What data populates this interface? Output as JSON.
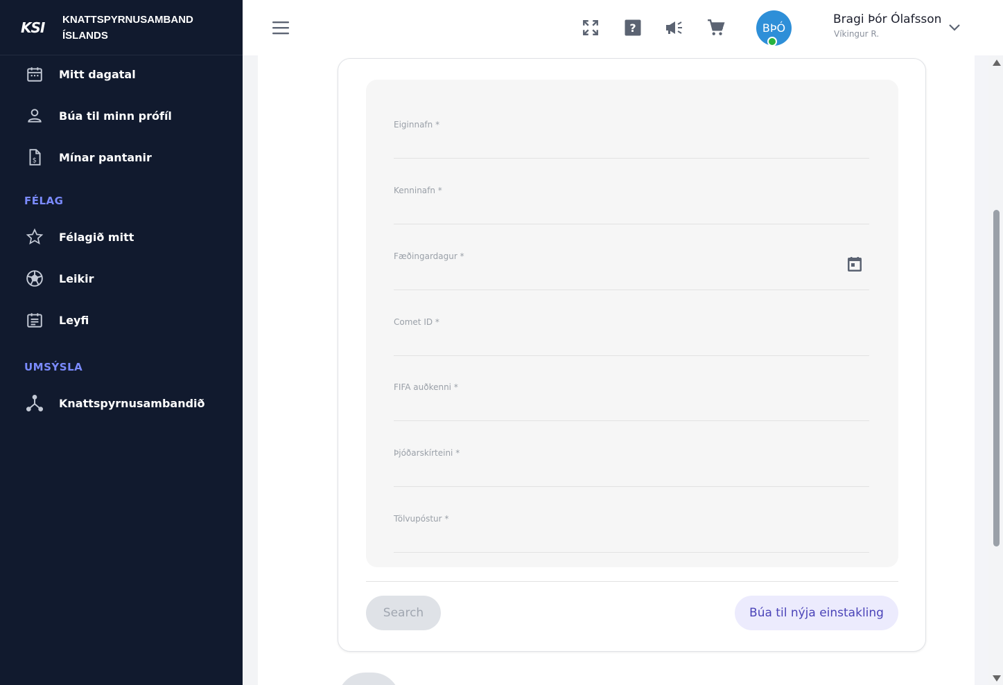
{
  "brand": {
    "logo_text": "KSI",
    "name_line1": "KNATTSPYRNUSAMBAND",
    "name_line2": "ÍSLANDS"
  },
  "sidebar": {
    "personal_items": [
      {
        "label": "Mitt dagatal",
        "icon": "calendar-icon"
      },
      {
        "label": "Búa til minn prófíl",
        "icon": "person-icon"
      },
      {
        "label": "Mínar pantanir",
        "icon": "invoice-icon"
      }
    ],
    "section_felag": "FÉLAG",
    "felag_items": [
      {
        "label": "Félagið mitt",
        "icon": "star-icon"
      },
      {
        "label": "Leikir",
        "icon": "soccer-ball-icon"
      },
      {
        "label": "Leyfi",
        "icon": "license-icon"
      }
    ],
    "section_umsysla": "UMSÝSLA",
    "umsysla_items": [
      {
        "label": "Knattspyrnusambandið",
        "icon": "hierarchy-icon"
      }
    ]
  },
  "topbar": {
    "icons": [
      "menu-icon",
      "fullscreen-icon",
      "help-icon",
      "announcement-icon",
      "cart-icon"
    ],
    "avatar_initials": "BÞÓ",
    "user_name": "Bragi Þór Ólafsson",
    "user_club": "Víkingur R."
  },
  "form": {
    "fields": [
      {
        "label": "Eiginnafn *"
      },
      {
        "label": "Kenninafn *"
      },
      {
        "label": "Fæðingardagur *"
      },
      {
        "label": "Comet ID *"
      },
      {
        "label": "FIFA auðkenni *"
      },
      {
        "label": "Þjóðarskírteini *"
      },
      {
        "label": "Tölvupóstur *"
      }
    ],
    "search_button": "Search",
    "create_button": "Búa til nýja einstakling"
  },
  "colors": {
    "sidebar_bg": "#111a2e",
    "section_title": "#7b8bff",
    "avatar_bg": "#2e8fd8",
    "status_online": "#27b33f",
    "create_button_text": "#4a43b8"
  }
}
